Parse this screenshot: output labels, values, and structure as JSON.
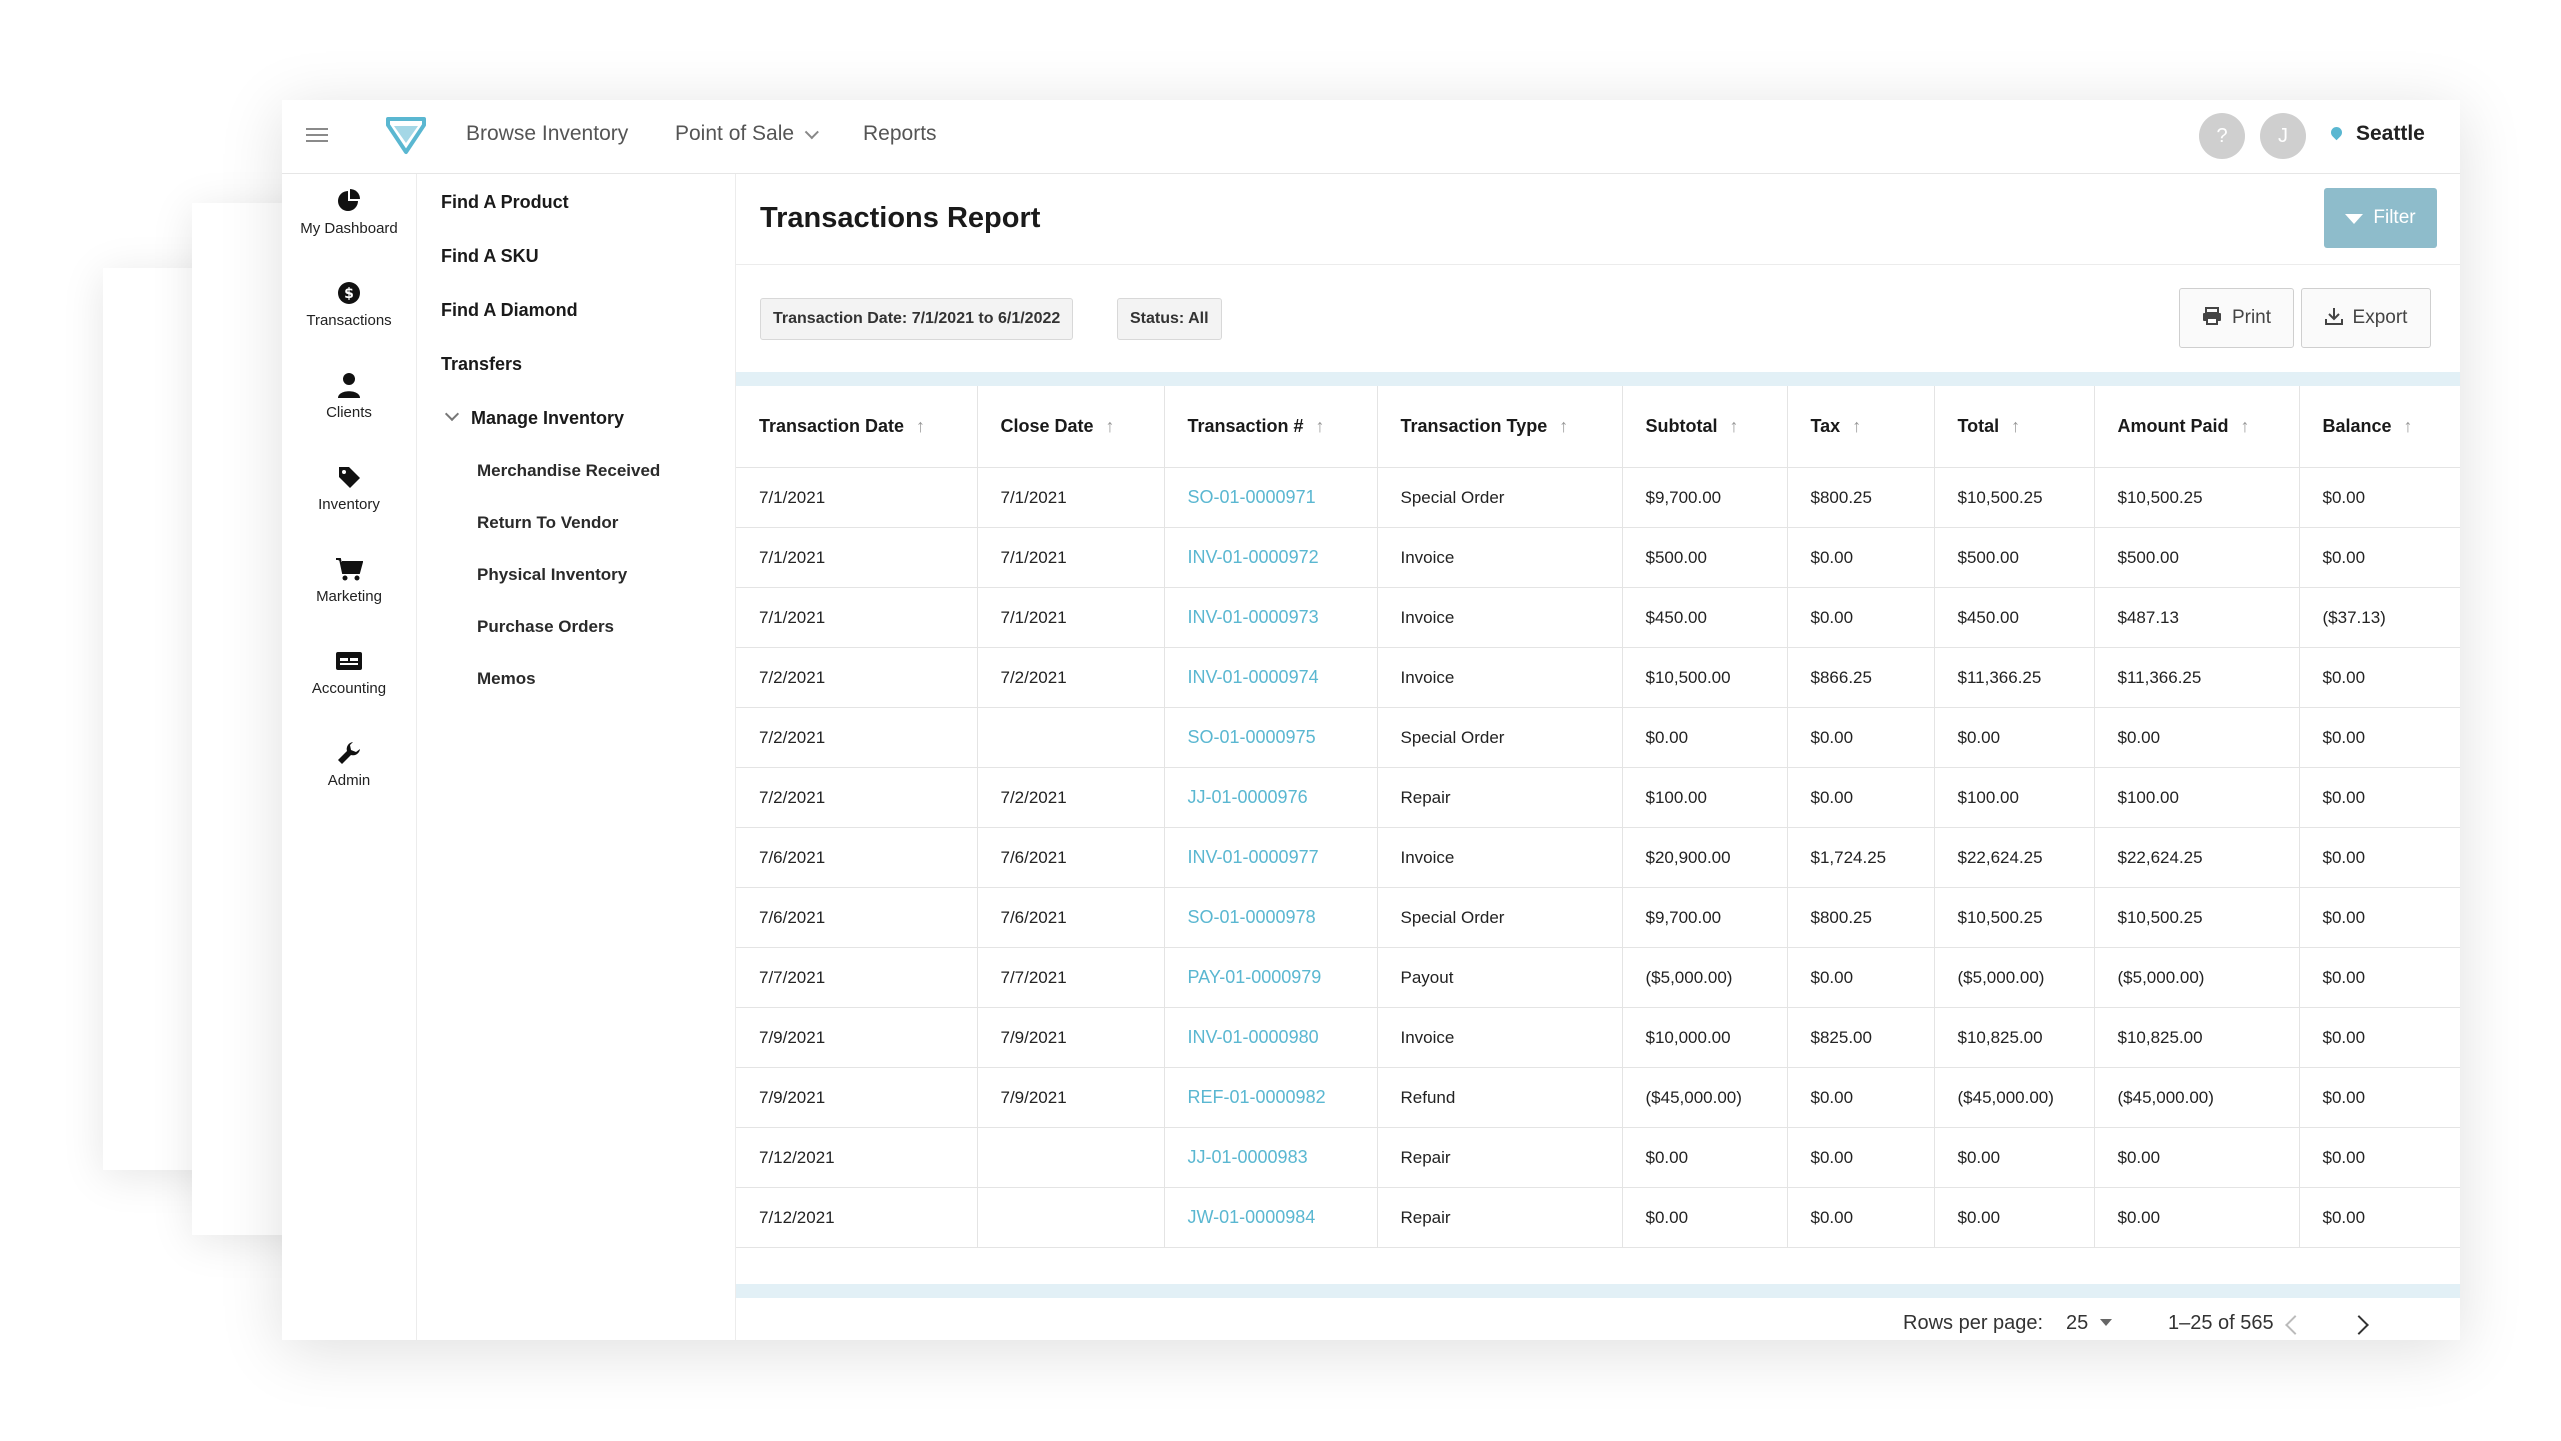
{
  "topbar": {
    "nav": [
      "Browse Inventory",
      "Point of Sale",
      "Reports"
    ],
    "help_label": "?",
    "user_initial": "J",
    "location": "Seattle"
  },
  "rail": [
    {
      "label": "My Dashboard",
      "icon": "pie-chart-icon"
    },
    {
      "label": "Transactions",
      "icon": "dollar-icon"
    },
    {
      "label": "Clients",
      "icon": "person-icon"
    },
    {
      "label": "Inventory",
      "icon": "tag-icon"
    },
    {
      "label": "Marketing",
      "icon": "cart-icon"
    },
    {
      "label": "Accounting",
      "icon": "card-icon"
    },
    {
      "label": "Admin",
      "icon": "wrench-icon"
    }
  ],
  "submenu": {
    "items": [
      "Find A Product",
      "Find A SKU",
      "Find A Diamond",
      "Transfers"
    ],
    "group_label": "Manage Inventory",
    "children": [
      "Merchandise Received",
      "Return To Vendor",
      "Physical Inventory",
      "Purchase Orders",
      "Memos"
    ]
  },
  "main": {
    "title": "Transactions Report",
    "filter_label": "Filter",
    "chip_date": "Transaction Date: 7/1/2021 to 6/1/2022",
    "chip_status": "Status: All",
    "print_label": "Print",
    "export_label": "Export"
  },
  "table": {
    "columns": [
      "Transaction Date",
      "Close Date",
      "Transaction #",
      "Transaction Type",
      "Subtotal",
      "Tax",
      "Total",
      "Amount Paid",
      "Balance"
    ],
    "rows": [
      [
        "7/1/2021",
        "7/1/2021",
        "SO-01-0000971",
        "Special Order",
        "$9,700.00",
        "$800.25",
        "$10,500.25",
        "$10,500.25",
        "$0.00"
      ],
      [
        "7/1/2021",
        "7/1/2021",
        "INV-01-0000972",
        "Invoice",
        "$500.00",
        "$0.00",
        "$500.00",
        "$500.00",
        "$0.00"
      ],
      [
        "7/1/2021",
        "7/1/2021",
        "INV-01-0000973",
        "Invoice",
        "$450.00",
        "$0.00",
        "$450.00",
        "$487.13",
        "($37.13)"
      ],
      [
        "7/2/2021",
        "7/2/2021",
        "INV-01-0000974",
        "Invoice",
        "$10,500.00",
        "$866.25",
        "$11,366.25",
        "$11,366.25",
        "$0.00"
      ],
      [
        "7/2/2021",
        "",
        "SO-01-0000975",
        "Special Order",
        "$0.00",
        "$0.00",
        "$0.00",
        "$0.00",
        "$0.00"
      ],
      [
        "7/2/2021",
        "7/2/2021",
        "JJ-01-0000976",
        "Repair",
        "$100.00",
        "$0.00",
        "$100.00",
        "$100.00",
        "$0.00"
      ],
      [
        "7/6/2021",
        "7/6/2021",
        "INV-01-0000977",
        "Invoice",
        "$20,900.00",
        "$1,724.25",
        "$22,624.25",
        "$22,624.25",
        "$0.00"
      ],
      [
        "7/6/2021",
        "7/6/2021",
        "SO-01-0000978",
        "Special Order",
        "$9,700.00",
        "$800.25",
        "$10,500.25",
        "$10,500.25",
        "$0.00"
      ],
      [
        "7/7/2021",
        "7/7/2021",
        "PAY-01-0000979",
        "Payout",
        "($5,000.00)",
        "$0.00",
        "($5,000.00)",
        "($5,000.00)",
        "$0.00"
      ],
      [
        "7/9/2021",
        "7/9/2021",
        "INV-01-0000980",
        "Invoice",
        "$10,000.00",
        "$825.00",
        "$10,825.00",
        "$10,825.00",
        "$0.00"
      ],
      [
        "7/9/2021",
        "7/9/2021",
        "REF-01-0000982",
        "Refund",
        "($45,000.00)",
        "$0.00",
        "($45,000.00)",
        "($45,000.00)",
        "$0.00"
      ],
      [
        "7/12/2021",
        "",
        "JJ-01-0000983",
        "Repair",
        "$0.00",
        "$0.00",
        "$0.00",
        "$0.00",
        "$0.00"
      ],
      [
        "7/12/2021",
        "",
        "JW-01-0000984",
        "Repair",
        "$0.00",
        "$0.00",
        "$0.00",
        "$0.00",
        "$0.00"
      ]
    ]
  },
  "footer": {
    "rows_per_page_label": "Rows per page:",
    "rows_per_page_value": "25",
    "range": "1–25 of 565"
  },
  "colors": {
    "accent": "#5ab7d1",
    "filter_button": "#8ebccb",
    "table_band": "#e2f0f6"
  }
}
